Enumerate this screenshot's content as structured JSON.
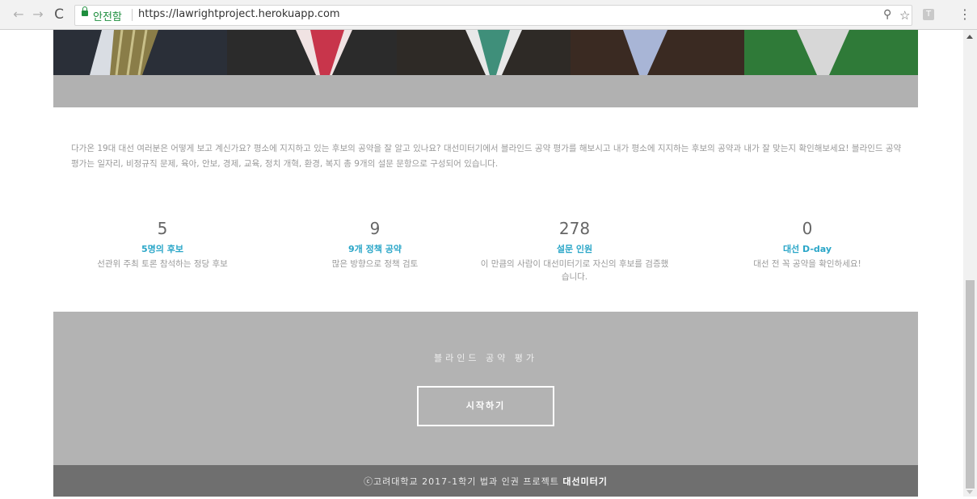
{
  "browser": {
    "secure_label": "안전함",
    "url": "https://lawrightproject.herokuapp.com",
    "extension_letter": "T"
  },
  "intro": {
    "text": "다가온 19대 대선 여러분은 어떻게 보고 계신가요? 평소에 지지하고 있는 후보의 공약을 잘 알고 있나요? 대선미터기에서 블라인드 공약 평가를 해보시고 내가 평소에 지지하는 후보의 공약과 내가 잘 맞는지 확인해보세요! 블라인드 공약 평가는 일자리, 비정규직 문제, 육아, 안보, 경제, 교육, 정치 개혁, 환경, 복지 총 9개의 설문 문항으로 구성되어 있습니다."
  },
  "stats": [
    {
      "number": "5",
      "title": "5명의 후보",
      "desc": "선관위 주최 토론 참석하는 정당 후보"
    },
    {
      "number": "9",
      "title": "9개 정책 공약",
      "desc": "많은 방향으로 정책 검토"
    },
    {
      "number": "278",
      "title": "설문 인원",
      "desc": "이 만큼의 사람이 대선미터기로 자신의 후보를 검증했습니다."
    },
    {
      "number": "0",
      "title": "대선 D-day",
      "desc": "대선 전 꼭 공약을 확인하세요!"
    }
  ],
  "cta": {
    "title": "블라인드 공약 평가",
    "button_label": "시작하기"
  },
  "footer": {
    "prefix": "ⓒ고려대학교 2017-1학기 법과 인권 프로젝트 ",
    "brand": "대선미터기"
  },
  "colors": {
    "accent": "#2aa6c8",
    "band": "#b1b1b1",
    "footer": "#6f6f6f",
    "secure": "#1e8e3e"
  },
  "icons": [
    "back-arrow-icon",
    "forward-arrow-icon",
    "reload-icon",
    "lock-icon",
    "zoom-icon",
    "star-icon",
    "menu-icon"
  ]
}
